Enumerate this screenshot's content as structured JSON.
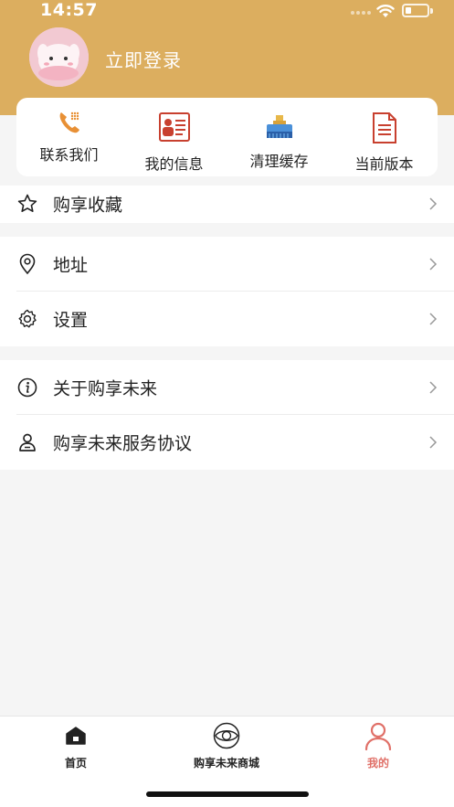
{
  "status_bar": {
    "time": "14:57"
  },
  "profile": {
    "login_label": "立即登录"
  },
  "quick_actions": [
    {
      "label": "联系我们",
      "icon": "phone-icon"
    },
    {
      "label": "我的信息",
      "icon": "id-card-icon"
    },
    {
      "label": "清理缓存",
      "icon": "broom-icon"
    },
    {
      "label": "当前版本",
      "icon": "document-icon"
    }
  ],
  "menu_groups": [
    [
      {
        "label": "购享收藏",
        "icon": "star-icon"
      }
    ],
    [
      {
        "label": "地址",
        "icon": "location-pin-icon"
      },
      {
        "label": "设置",
        "icon": "gear-icon"
      }
    ],
    [
      {
        "label": "关于购享未来",
        "icon": "info-icon"
      },
      {
        "label": "购享未来服务协议",
        "icon": "user-agreement-icon"
      }
    ]
  ],
  "tabbar": [
    {
      "label": "首页",
      "icon": "home-icon",
      "active": false
    },
    {
      "label": "购享未来商城",
      "icon": "eye-logo-icon",
      "active": false
    },
    {
      "label": "我的",
      "icon": "profile-icon",
      "active": true
    }
  ],
  "colors": {
    "header": "#dcae5f",
    "accent": "#e07068",
    "background": "#f5f5f5"
  }
}
